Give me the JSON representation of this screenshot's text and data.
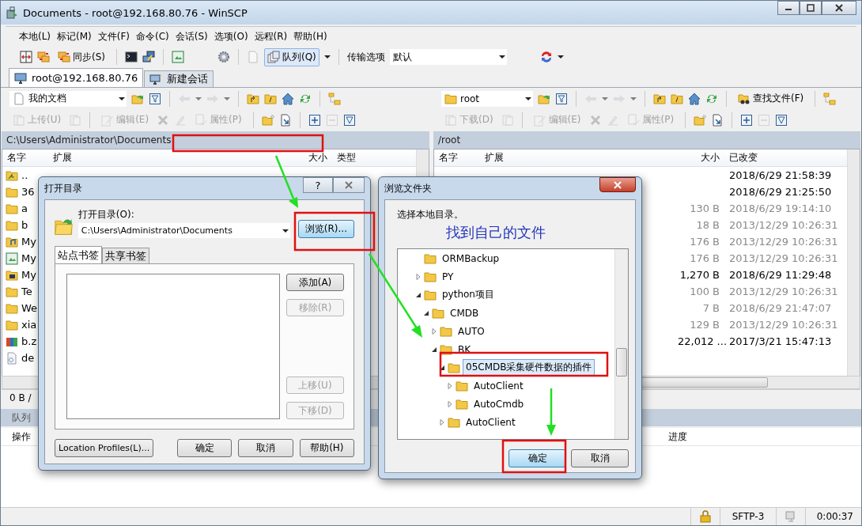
{
  "window": {
    "title": "Documents - root@192.168.80.76 - WinSCP"
  },
  "menu": [
    "本地(L)",
    "标记(M)",
    "文件(F)",
    "命令(C)",
    "会话(S)",
    "选项(O)",
    "远程(R)",
    "帮助(H)"
  ],
  "toolbar": {
    "sync_label": "同步(S)",
    "queue_label": "队列(Q)",
    "transfer_label": "传输选项",
    "transfer_value": "默认"
  },
  "session_tabs": [
    {
      "label": "root@192.168.80.76",
      "selected": true
    },
    {
      "label": "新建会话",
      "selected": false
    }
  ],
  "local_pane": {
    "location": "我的文档",
    "upload": "上传(U)",
    "edit": "编辑(E)",
    "properties": "属性(P)",
    "path": "C:\\Users\\Administrator\\Documents",
    "columns": [
      "名字",
      "扩展",
      "大小",
      "类型"
    ],
    "rows": [
      {
        "name": "..",
        "kind": "parent"
      },
      {
        "name": "36",
        "kind": "folder"
      },
      {
        "name": "a",
        "kind": "folder"
      },
      {
        "name": "b",
        "kind": "folder"
      },
      {
        "name": "My",
        "kind": "music"
      },
      {
        "name": "My",
        "kind": "picture"
      },
      {
        "name": "My",
        "kind": "video"
      },
      {
        "name": "Te",
        "kind": "folder"
      },
      {
        "name": "We",
        "kind": "folder"
      },
      {
        "name": "xia",
        "kind": "folder"
      },
      {
        "name": "b.z",
        "kind": "archive"
      },
      {
        "name": "de",
        "kind": "document"
      }
    ],
    "status": "0 B /"
  },
  "remote_pane": {
    "location": "root",
    "find": "查找文件(F)",
    "download": "下载(D)",
    "edit": "编辑(E)",
    "properties": "属性(P)",
    "path": "/root",
    "columns": [
      "名字",
      "扩展",
      "大小",
      "已改变"
    ],
    "rows": [
      {
        "size": "",
        "changed": "2018/6/29 21:58:39",
        "hidden": false
      },
      {
        "size": "",
        "changed": "2018/6/29 21:25:50",
        "hidden": false
      },
      {
        "size": "130 B",
        "changed": "2018/6/29 19:14:10",
        "hidden": true
      },
      {
        "size": "18 B",
        "changed": "2013/12/29 10:26:31",
        "hidden": true
      },
      {
        "size": "176 B",
        "changed": "2013/12/29 10:26:31",
        "hidden": true
      },
      {
        "size": "176 B",
        "changed": "2013/12/29 10:26:31",
        "hidden": true
      },
      {
        "size": "1,270 B",
        "changed": "2018/6/29 11:29:48",
        "hidden": false
      },
      {
        "size": "100 B",
        "changed": "2013/12/29 10:26:31",
        "hidden": true
      },
      {
        "size": "7 B",
        "changed": "2018/6/29 21:47:07",
        "hidden": true
      },
      {
        "size": "129 B",
        "changed": "2013/12/29 10:26:31",
        "hidden": true
      },
      {
        "size": "22,012 ...",
        "changed": "2017/3/21 15:47:13",
        "hidden": false
      }
    ]
  },
  "queue": {
    "title": "队列",
    "columns": [
      "操作",
      "进度"
    ]
  },
  "status_bar": {
    "protocol": "SFTP-3",
    "time": "0:00:37"
  },
  "open_dialog": {
    "title": "打开目录",
    "help": "?",
    "label": "打开目录(O):",
    "path": "C:\\Users\\Administrator\\Documents",
    "browse": "浏览(R)...",
    "tabs": [
      {
        "label": "站点书签",
        "selected": true
      },
      {
        "label": "共享书签",
        "selected": false
      }
    ],
    "side_buttons": [
      {
        "label": "添加(A)",
        "disabled": false
      },
      {
        "label": "移除(R)",
        "disabled": true
      },
      {
        "label": "上移(U)",
        "disabled": true
      },
      {
        "label": "下移(D)",
        "disabled": true
      }
    ],
    "buttons": [
      "Location Profiles(L)...",
      "确定",
      "取消",
      "帮助(H)"
    ]
  },
  "browse_dialog": {
    "title": "浏览文件夹",
    "prompt": "选择本地目录。",
    "annotation": "找到自己的文件",
    "tree": [
      {
        "label": "ORMBackup",
        "selected": false
      },
      {
        "label": "PY",
        "selected": false,
        "expanded": false
      },
      {
        "label": "python项目",
        "selected": false,
        "expanded": true,
        "children": [
          {
            "label": "CMDB",
            "selected": false,
            "expanded": true,
            "children": [
              {
                "label": "AUTO",
                "selected": false,
                "expanded": false
              },
              {
                "label": "BK",
                "selected": false,
                "expanded": true,
                "children": [
                  {
                    "label": "05CMDB采集硬件数据的插件",
                    "selected": true,
                    "expanded": true,
                    "children": [
                      {
                        "label": "AutoClient",
                        "selected": false,
                        "expanded": false
                      },
                      {
                        "label": "AutoCmdb",
                        "selected": false,
                        "expanded": false
                      }
                    ]
                  },
                  {
                    "label": "AutoClient",
                    "selected": false,
                    "expanded": false
                  }
                ]
              }
            ]
          }
        ]
      }
    ],
    "ok": "确定",
    "cancel": "取消"
  }
}
